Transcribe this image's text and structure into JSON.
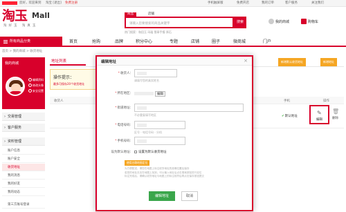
{
  "topbar": {
    "login_prefix": "您好，欢迎来到",
    "site": "淘宝 [退出]",
    "free_reg": "免费注册",
    "links": [
      "手机触屏版",
      "免费开店",
      "我的订单",
      "客户服务",
      "关注我们"
    ]
  },
  "logo": {
    "zh": "淘玉",
    "mall": "Mall",
    "sub": "淘好玉 淘真玉"
  },
  "search": {
    "tab_active": "商品",
    "tab_other": "店铺",
    "placeholder": "请输入您要搜索的商品关键字",
    "button": "搜索",
    "hot": "热门搜索：和田玉  玛瑙  翡翠手镯  原石"
  },
  "header": {
    "mytaobao": "我的商城",
    "cart": "购物车"
  },
  "nav": {
    "all": "所有商品分类",
    "items": [
      "首页",
      "抢购",
      "品牌",
      "积分中心",
      "专题",
      "店铺",
      "圈子",
      "微商城",
      "门户"
    ]
  },
  "breadcrumb": "首页 > 我的商城 > 收货地址",
  "sidebar": {
    "title": "我的商城",
    "links": [
      "编辑资料",
      "修改头像",
      "安全设置"
    ],
    "sections": [
      "交易管理",
      "客户服务",
      "资料管理"
    ],
    "items": [
      "账户信息",
      "账户安全",
      "收货地址",
      "我的消息",
      "我的好友",
      "我的动态",
      "第三方账号登录"
    ],
    "active_index": 2
  },
  "main": {
    "tab": "地址列表",
    "btn_add": "新增地址",
    "btn_default": "新增默认收货地址",
    "tip_title": "操作提示：",
    "tip_body": "最多可保存20个收货地址",
    "col_receiver": "收货人",
    "col_phone": "手机",
    "col_op": "操作",
    "default_label": "默认地址",
    "edit": "编辑",
    "delete": "删除"
  },
  "modal": {
    "title": "编辑地址",
    "close": "×",
    "labels": {
      "receiver": "收货人：",
      "area": "所在地区：",
      "street": "街道地址：",
      "phone": "电话号码：",
      "mobile": "手机号码：",
      "default": "设为默认地址："
    },
    "hints": {
      "receiver": "请填写您的真实姓名",
      "street": "不必重复填写地区",
      "phone": "区号 - 电话号码 - 分机"
    },
    "area_edit": "编辑",
    "checkbox_label": "设置为默认收货地址",
    "yellow_btn": "使用谷歌地图定位",
    "note_lines": [
      "为方便配送，请您在地图上标注收货地址的准确位置后保存",
      "若您的地址无法在地图上找到，可以输入地址后点击搜索按钮进行定位",
      "标注完成后，请确认收货地址与地图上的标注相符后再点击保存按钮提交"
    ],
    "save": "编辑地址",
    "cancel": "取消"
  },
  "colors": {
    "brand": "#d8002b",
    "accent_orange": "#f5a623",
    "save_green": "#3aa64b"
  }
}
